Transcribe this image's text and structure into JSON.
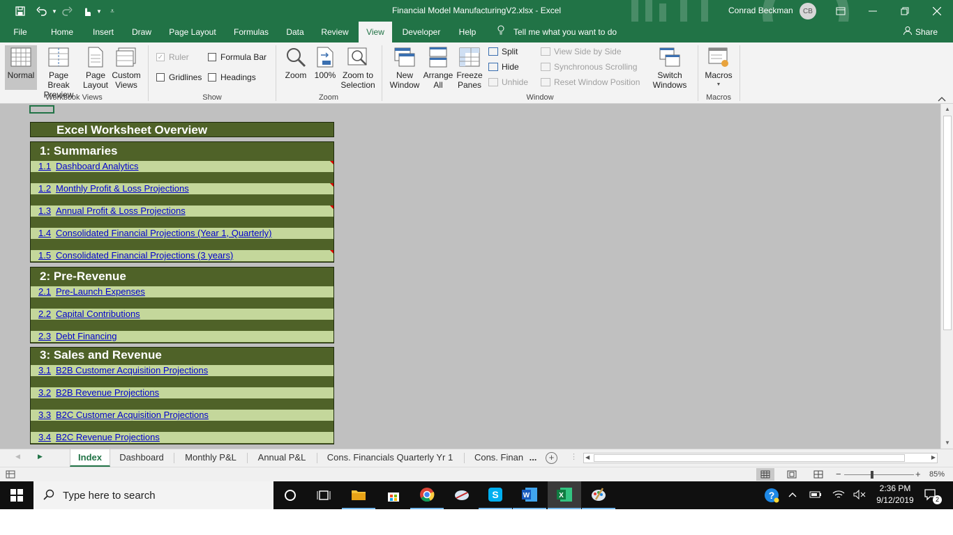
{
  "window": {
    "title": "Financial Model ManufacturingV2.xlsx  -  Excel",
    "user_name": "Conrad Beckman",
    "user_initials": "CB"
  },
  "ribbon_tabs": [
    "File",
    "Home",
    "Insert",
    "Draw",
    "Page Layout",
    "Formulas",
    "Data",
    "Review",
    "View",
    "Developer",
    "Help"
  ],
  "active_tab": "View",
  "tell_me": "Tell me what you want to do",
  "share": "Share",
  "ribbon": {
    "workbook_views": {
      "label": "Workbook Views",
      "normal": "Normal",
      "page_break_1": "Page Break",
      "page_break_2": "Preview",
      "page_layout_1": "Page",
      "page_layout_2": "Layout",
      "custom_1": "Custom",
      "custom_2": "Views"
    },
    "show": {
      "label": "Show",
      "ruler": "Ruler",
      "formula_bar": "Formula Bar",
      "gridlines": "Gridlines",
      "headings": "Headings"
    },
    "zoom": {
      "label": "Zoom",
      "zoom": "Zoom",
      "hundred": "100%",
      "to_sel_1": "Zoom to",
      "to_sel_2": "Selection"
    },
    "window": {
      "label": "Window",
      "new_1": "New",
      "new_2": "Window",
      "arrange_1": "Arrange",
      "arrange_2": "All",
      "freeze_1": "Freeze",
      "freeze_2": "Panes",
      "split": "Split",
      "hide": "Hide",
      "unhide": "Unhide",
      "side_by_side": "View Side by Side",
      "sync_scroll": "Synchronous Scrolling",
      "reset_pos": "Reset Window Position",
      "switch_1": "Switch",
      "switch_2": "Windows"
    },
    "macros": {
      "label": "Macros",
      "macros": "Macros"
    }
  },
  "worksheet": {
    "title": "Excel Worksheet Overview",
    "sections": [
      {
        "heading": "1:  Summaries",
        "items": [
          {
            "num": "1.1",
            "label": "Dashboard Analytics"
          },
          {
            "num": "1.2",
            "label": "Monthly Profit & Loss Projections"
          },
          {
            "num": "1.3",
            "label": "Annual Profit & Loss Projections"
          },
          {
            "num": "1.4",
            "label": "Consolidated Financial Projections (Year 1, Quarterly)"
          },
          {
            "num": "1.5",
            "label": "Consolidated Financial Projections (3 years)"
          }
        ]
      },
      {
        "heading": "2:  Pre-Revenue",
        "items": [
          {
            "num": "2.1",
            "label": "Pre-Launch Expenses"
          },
          {
            "num": "2.2",
            "label": "Capital Contributions"
          },
          {
            "num": "2.3",
            "label": "Debt Financing"
          }
        ]
      },
      {
        "heading": "3:  Sales and Revenue",
        "items": [
          {
            "num": "3.1",
            "label": "B2B Customer Acquisition Projections"
          },
          {
            "num": "3.2",
            "label": "B2B Revenue Projections"
          },
          {
            "num": "3.3",
            "label": "B2C Customer Acquisition Projections"
          },
          {
            "num": "3.4",
            "label": "B2C Revenue Projections"
          }
        ]
      }
    ]
  },
  "sheet_tabs": [
    "Index",
    "Dashboard",
    "Monthly P&L",
    "Annual P&L",
    "Cons. Financials Quarterly Yr 1",
    "Cons. Finan"
  ],
  "sheet_tabs_more": "...",
  "status": {
    "zoom": "85%"
  },
  "taskbar": {
    "search_placeholder": "Type here to search",
    "time": "2:36 PM",
    "date": "9/12/2019",
    "notification_count": "2"
  },
  "colors": {
    "excel_green": "#217346",
    "section_dark": "#4f6228",
    "row_light": "#c4d79b",
    "link_blue": "#0000cc"
  }
}
